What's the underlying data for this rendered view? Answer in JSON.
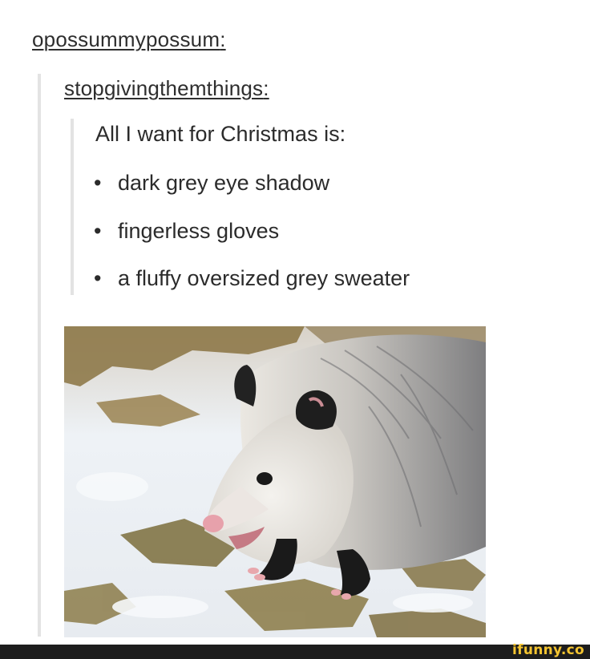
{
  "post": {
    "reblog_user": "opossummypossum",
    "original_user": "stopgivingthemthings",
    "text": "All I want for Christmas is:",
    "items": [
      "dark grey eye shadow",
      "fingerless gloves",
      "a fluffy oversized grey sweater"
    ],
    "bullet": "•",
    "colon": ":"
  },
  "image": {
    "subject": "opossum in snow",
    "colors": {
      "fur_light": "#e9e6e1",
      "fur_grey": "#8f8f8f",
      "snow": "#eef2f6",
      "grass": "#8a7442"
    }
  },
  "watermark": {
    "text": "ifunny.co",
    "color": "#f4c430",
    "bar_color": "#1d1d1d"
  }
}
